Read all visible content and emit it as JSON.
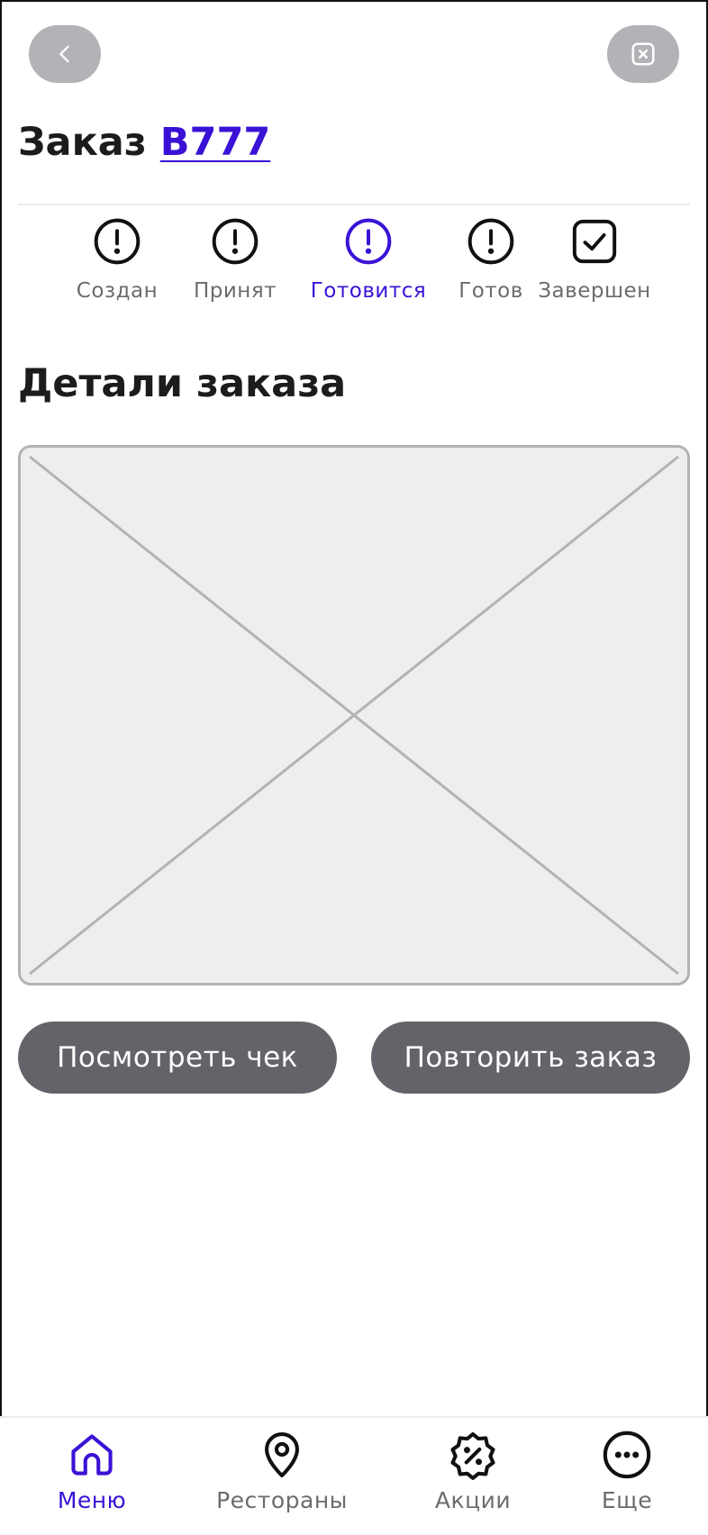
{
  "header": {
    "title_prefix": "Заказ",
    "order_number": "B777"
  },
  "statuses": [
    {
      "label": "Создан",
      "icon": "alert-circle-icon",
      "active": false
    },
    {
      "label": "Принят",
      "icon": "alert-circle-icon",
      "active": false
    },
    {
      "label": "Готовится",
      "icon": "alert-circle-icon",
      "active": true
    },
    {
      "label": "Готов",
      "icon": "alert-circle-icon",
      "active": false
    },
    {
      "label": "Завершен",
      "icon": "check-square-icon",
      "active": false
    }
  ],
  "details": {
    "title": "Детали заказа",
    "image": "image-placeholder"
  },
  "actions": {
    "view_receipt": "Посмотреть чек",
    "repeat_order": "Повторить заказ"
  },
  "bottom_nav": [
    {
      "label": "Меню",
      "icon": "home-icon",
      "active": true
    },
    {
      "label": "Рестораны",
      "icon": "map-pin-icon",
      "active": false
    },
    {
      "label": "Акции",
      "icon": "discount-badge-icon",
      "active": false
    },
    {
      "label": "Еще",
      "icon": "more-horizontal-icon",
      "active": false
    }
  ],
  "colors": {
    "accent": "#3a12d6",
    "button": "#636469",
    "top_button": "#b3b3b7",
    "placeholder_bg": "#eeeeee",
    "muted_text": "#6c6c70"
  }
}
